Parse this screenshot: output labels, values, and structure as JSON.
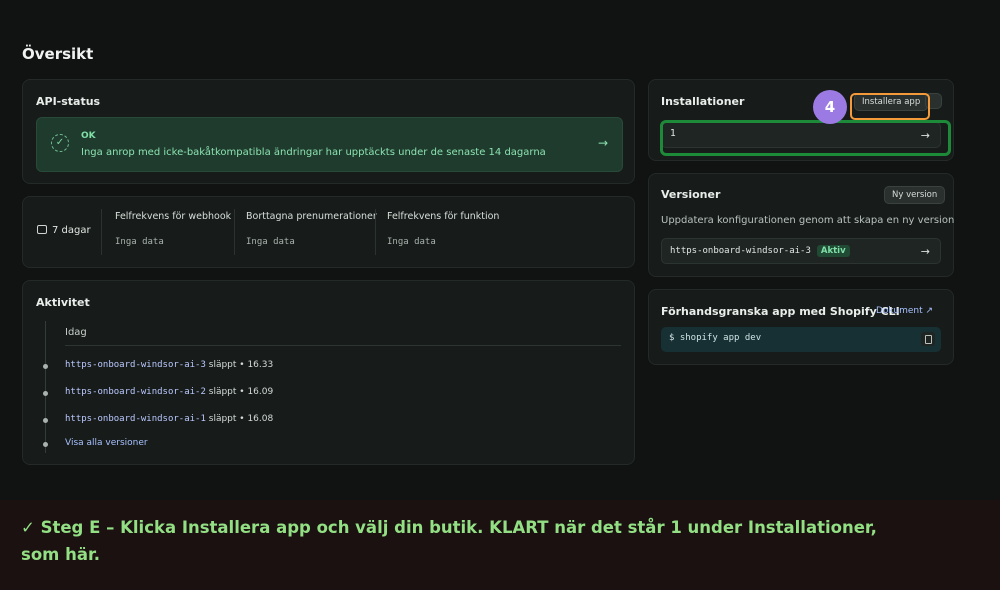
{
  "page": {
    "title": "Översikt"
  },
  "api_status": {
    "title": "API-status",
    "status": "OK",
    "message": "Inga anrop med icke-bakåtkompatibla ändringar har upptäckts under de senaste 14 dagarna"
  },
  "metrics": {
    "period": "7 dagar",
    "items": [
      {
        "label": "Felfrekvens för webhook",
        "value": "Inga data"
      },
      {
        "label": "Borttagna prenumerationer",
        "value": "Inga data"
      },
      {
        "label": "Felfrekvens för funktion",
        "value": "Inga data"
      }
    ]
  },
  "activity": {
    "title": "Aktivitet",
    "today": "Idag",
    "entries": [
      {
        "name": "https-onboard-windsor-ai-3",
        "action": " släppt • 16.33"
      },
      {
        "name": "https-onboard-windsor-ai-2",
        "action": " släppt • 16.09"
      },
      {
        "name": "https-onboard-windsor-ai-1",
        "action": " släppt • 16.08"
      }
    ],
    "show_all": "Visa alla versioner"
  },
  "installations": {
    "title": "Installationer",
    "install_button": "Installera app",
    "count": "1"
  },
  "versions": {
    "title": "Versioner",
    "new_version_button": "Ny version",
    "description": "Uppdatera konfigurationen genom att skapa en ny version",
    "current": "https-onboard-windsor-ai-3",
    "active_badge": "Aktiv"
  },
  "preview": {
    "title": "Förhandsgranska app med Shopify CLI",
    "doc_link": "Dokument",
    "command": "$ shopify app dev"
  },
  "overlay": {
    "step_number": "4",
    "caption": "✓ Steg E – Klicka Installera app och välj din butik. KLART när det står 1 under Installationer, som här."
  },
  "colors": {
    "background": "#101312",
    "card": "#171c1a",
    "status_ok": "#1f3b2d",
    "accent_green": "#93df84",
    "marker_purple": "#9b7be3",
    "highlight_orange": "#f59a3a",
    "highlight_green": "#1d8a3a"
  }
}
